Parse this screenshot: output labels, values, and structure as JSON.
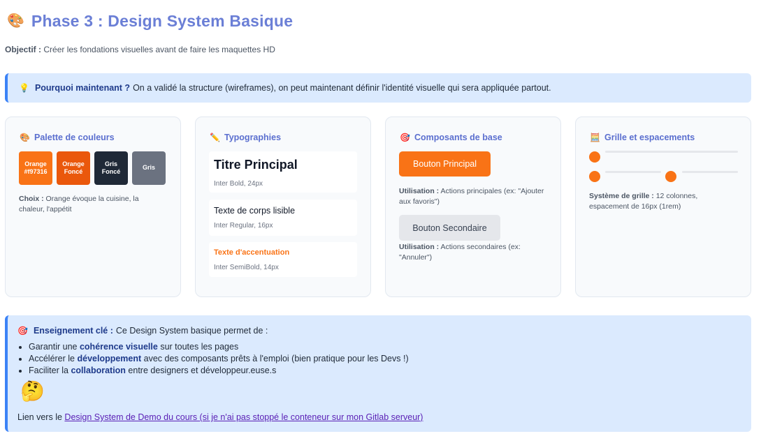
{
  "header": {
    "icon": "palette-icon",
    "title": "Phase 3 : Design System Basique",
    "objective_label": "Objectif :",
    "objective_text": "Créer les fondations visuelles avant de faire les maquettes HD"
  },
  "callout": {
    "icon": "lightbulb-icon",
    "label": "Pourquoi maintenant ?",
    "text": "On a validé la structure (wireframes), on peut maintenant définir l'identité visuelle qui sera appliquée partout."
  },
  "palette_card": {
    "icon": "palette-icon",
    "title": "Palette de couleurs",
    "swatches": [
      {
        "line1": "Orange",
        "line2": "#f97316",
        "color": "#f97316"
      },
      {
        "line1": "Orange",
        "line2": "Foncé",
        "color": "#ea580c"
      },
      {
        "line1": "Gris",
        "line2": "Foncé",
        "color": "#1f2937"
      },
      {
        "line1": "Gris",
        "line2": "",
        "color": "#6b7280"
      }
    ],
    "note_label": "Choix :",
    "note_text": "Orange évoque la cuisine, la chaleur, l'appétit"
  },
  "typography_card": {
    "icon": "pencil-icon",
    "title": "Typographies",
    "samples": [
      {
        "text": "Titre Principal",
        "meta": "Inter Bold, 24px"
      },
      {
        "text": "Texte de corps lisible",
        "meta": "Inter Regular, 16px"
      },
      {
        "text": "Texte d'accentuation",
        "meta": "Inter SemiBold, 14px"
      }
    ]
  },
  "components_card": {
    "icon": "target-icon",
    "title": "Composants de base",
    "primary_button": "Bouton Principal",
    "primary_usage_label": "Utilisation :",
    "primary_usage_text": "Actions principales (ex: \"Ajouter aux favoris\")",
    "secondary_button": "Bouton Secondaire",
    "secondary_usage_label": "Utilisation :",
    "secondary_usage_text": "Actions secondaires (ex: \"Annuler\")"
  },
  "grid_card": {
    "icon": "calculator-icon",
    "title": "Grille et espacements",
    "note_label": "Système de grille :",
    "note_text": "12 colonnes, espacement de 16px (1rem)"
  },
  "lesson": {
    "icon": "target-icon",
    "label": "Enseignement clé :",
    "intro": "Ce Design System basique permet de :",
    "items": [
      {
        "before": "Garantir une",
        "bold": "cohérence visuelle",
        "after": "sur toutes les pages"
      },
      {
        "before": "Accélérer le",
        "bold": "développement",
        "after": "avec des composants prêts à l'emploi (bien pratique pour les Devs !)"
      },
      {
        "before": "Faciliter la",
        "bold": "collaboration",
        "after": "entre designers et développeur.euse.s"
      }
    ],
    "emoji": "🤔",
    "link_prefix": "Lien vers le",
    "link_text": "Design System de Demo du cours (si je n'ai pas stoppé le conteneur sur mon Gitlab serveur)"
  },
  "colors": {
    "accent": "#f97316",
    "title": "#6b7fd6",
    "callout_bg": "#dbeafe",
    "callout_border": "#3b82f6"
  }
}
